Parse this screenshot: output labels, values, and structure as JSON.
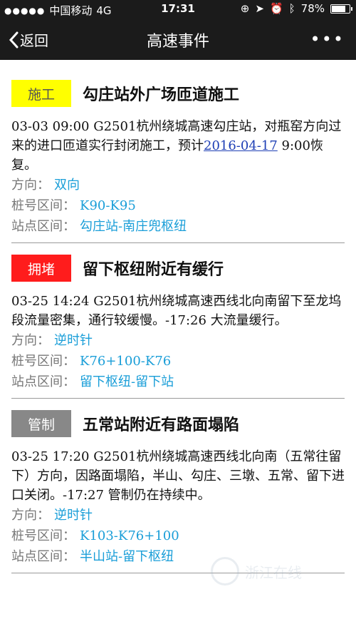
{
  "status_bar": {
    "carrier": "中国移动",
    "network": "4G",
    "time": "17:31",
    "battery": "78%",
    "battery_level": 0.78
  },
  "nav": {
    "back_label": "返回",
    "title": "高速事件",
    "more_label": "•••"
  },
  "events": [
    {
      "tag": "施工",
      "tag_color": "#ffff00",
      "title": "勾庄站外广场匝道施工",
      "desc_prefix": "03-03 09:00 G2501杭州绕城高速勾庄站，对瓶窑方向过来的进口匝道实行封闭施工，预计",
      "desc_link": "2016-04-17",
      "desc_suffix": " 9:00恢复。",
      "direction_label": "方向：",
      "direction": "双向",
      "mileage_label": "桩号区间：",
      "mileage": "K90-K95",
      "station_label": "站点区间：",
      "station": "勾庄站-南庄兜枢纽"
    },
    {
      "tag": "拥堵",
      "tag_color": "#ff1c1c",
      "title": "留下枢纽附近有缓行",
      "desc": "03-25 14:24 G2501杭州绕城高速西线北向南留下至龙坞段流量密集，通行较缓慢。-17:26 大流量缓行。",
      "direction_label": "方向：",
      "direction": "逆时针",
      "mileage_label": "桩号区间：",
      "mileage": "K76+100-K76",
      "station_label": "站点区间：",
      "station": "留下枢纽-留下站"
    },
    {
      "tag": "管制",
      "tag_color": "#888888",
      "title": "五常站附近有路面塌陷",
      "desc": "03-25 17:20 G2501杭州绕城高速西线北向南（五常往留下）方向，因路面塌陷，半山、勾庄、三墩、五常、留下进口关闭。-17:27 管制仍在持续中。",
      "direction_label": "方向：",
      "direction": "逆时针",
      "mileage_label": "桩号区间：",
      "mileage": "K103-K76+100",
      "station_label": "站点区间：",
      "station": "半山站-留下枢纽"
    }
  ],
  "watermark": "浙江在线",
  "colors": {
    "bar_bg": "#1b1b1b",
    "value_blue": "#1a9ed8",
    "link_blue": "#1e3fb5"
  }
}
